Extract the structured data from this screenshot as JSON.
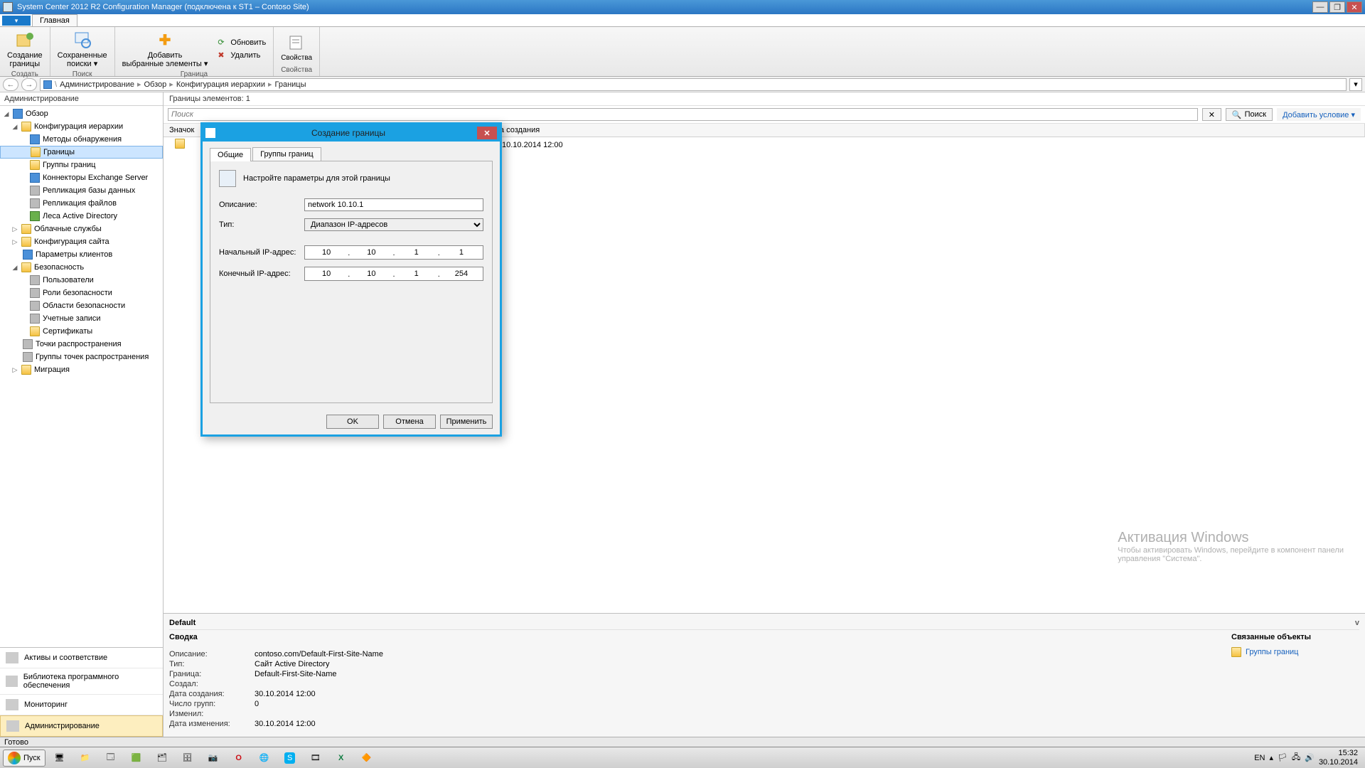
{
  "window": {
    "title": "System Center 2012 R2 Configuration Manager (подключена к ST1 – Contoso Site)"
  },
  "mainTab": {
    "file": "▾",
    "tab1": "Главная"
  },
  "ribbon": {
    "group_create": {
      "label": "Создать",
      "btn1_l1": "Создание",
      "btn1_l2": "границы"
    },
    "group_search": {
      "label": "Поиск",
      "btn1_l1": "Сохраненные",
      "btn1_l2": "поиски ▾"
    },
    "group_boundary": {
      "label": "Граница",
      "btn1_l1": "Добавить",
      "btn1_l2": "выбранные элементы ▾",
      "refresh": "Обновить",
      "delete": "Удалить"
    },
    "group_props": {
      "label": "Свойства",
      "btn1": "Свойства"
    }
  },
  "breadcrumb": {
    "items": [
      "Администрирование",
      "Обзор",
      "Конфигурация иерархии",
      "Границы"
    ]
  },
  "leftPane": {
    "header": "Администрирование",
    "tree": {
      "root": "Обзор",
      "n0": "Конфигурация иерархии",
      "n0_0": "Методы обнаружения",
      "n0_1": "Границы",
      "n0_2": "Группы границ",
      "n0_3": "Коннекторы Exchange Server",
      "n0_4": "Репликация базы данных",
      "n0_5": "Репликация файлов",
      "n0_6": "Леса Active Directory",
      "n1": "Облачные службы",
      "n2": "Конфигурация сайта",
      "n3": "Параметры клиентов",
      "n4": "Безопасность",
      "n4_0": "Пользователи",
      "n4_1": "Роли безопасности",
      "n4_2": "Области безопасности",
      "n4_3": "Учетные записи",
      "n4_4": "Сертификаты",
      "n5": "Точки распространения",
      "n6": "Группы точек распространения",
      "n7": "Миграция"
    },
    "nav": {
      "n1": "Активы и соответствие",
      "n2": "Библиотека программного обеспечения",
      "n3": "Мониторинг",
      "n4": "Администрирование"
    }
  },
  "list": {
    "header": "Границы элементов: 1",
    "searchPlaceholder": "Поиск",
    "searchBtn": "Поиск",
    "addCond": "Добавить условие ▾",
    "cols": {
      "c0": "Значок",
      "c1": "",
      "c2": "",
      "c3": "та создания"
    },
    "row0_date": "10.10.2014 12:00"
  },
  "detail": {
    "title": "Default",
    "summary": "Сводка",
    "related": "Связанные объекты",
    "relatedLink": "Группы границ",
    "k_desc": "Описание:",
    "v_desc": "contoso.com/Default-First-Site-Name",
    "k_type": "Тип:",
    "v_type": "Сайт Active Directory",
    "k_bound": "Граница:",
    "v_bound": "Default-First-Site-Name",
    "k_creator": "Создал:",
    "v_creator": "",
    "k_cdate": "Дата создания:",
    "v_cdate": "30.10.2014 12:00",
    "k_groups": "Число групп:",
    "v_groups": "0",
    "k_mod": "Изменил:",
    "v_mod": "",
    "k_mdate": "Дата изменения:",
    "v_mdate": "30.10.2014 12:00"
  },
  "watermark": {
    "l1": "Активация Windows",
    "l2": "Чтобы активировать Windows, перейдите в компонент панели",
    "l3": "управления \"Система\"."
  },
  "status": "Готово",
  "dialog": {
    "title": "Создание границы",
    "tab1": "Общие",
    "tab2": "Группы границ",
    "instr": "Настройте параметры для этой границы",
    "lbl_desc": "Описание:",
    "val_desc": "network 10.10.1",
    "lbl_type": "Тип:",
    "val_type": "Диапазон IP-адресов",
    "lbl_start": "Начальный IP-адрес:",
    "start": {
      "a": "10",
      "b": "10",
      "c": "1",
      "d": "1"
    },
    "lbl_end": "Конечный IP-адрес:",
    "end": {
      "a": "10",
      "b": "10",
      "c": "1",
      "d": "254"
    },
    "btn_ok": "OK",
    "btn_cancel": "Отмена",
    "btn_apply": "Применить"
  },
  "taskbar": {
    "start": "Пуск",
    "lang": "EN",
    "time": "15:32",
    "date": "30.10.2014"
  }
}
